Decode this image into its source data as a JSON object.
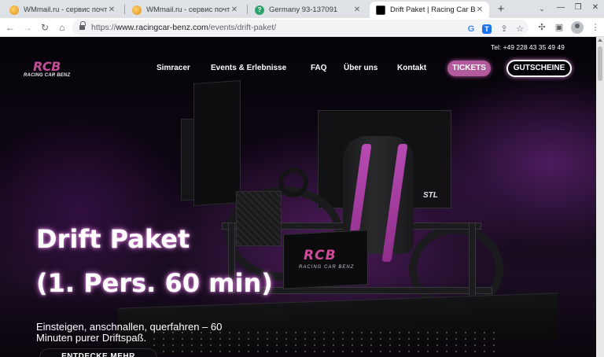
{
  "browser": {
    "tabs": [
      {
        "title": "WMmail.ru - сервис почтовы",
        "icon": "wmmail-favicon"
      },
      {
        "title": "WMmail.ru - сервис почтовы",
        "icon": "wmmail-favicon"
      },
      {
        "title": "Germany 93-137091",
        "icon": "question-favicon"
      },
      {
        "title": "Drift Paket | Racing Car Benz",
        "icon": "rcb-favicon",
        "active": true
      }
    ],
    "new_tab": "+",
    "url_scheme": "https://",
    "url_host": "www.racingcar-benz.com",
    "url_path": "/events/drift-paket/"
  },
  "site": {
    "logo_mark": "RCB",
    "logo_text": "RACING CAR BENZ",
    "phone": "Tel: +49 228 43 35 49 49",
    "nav": {
      "simracer": "Simracer",
      "events": "Events & Erlebnisse",
      "faq": "FAQ",
      "ueber_uns": "Über uns",
      "kontakt": "Kontakt",
      "tickets": "TICKETS",
      "gutscheine": "GUTSCHEINE"
    },
    "hero": {
      "title_line1": "Drift Paket",
      "title_line2": "(1. Pers. 60 min)",
      "subtitle": "Einsteigen, anschnallen, querfahren – 60 Minuten purer Driftspaß.",
      "cta": "ENTDECKE MEHR"
    },
    "simulator": {
      "base_logo": "RCB",
      "base_sub": "RACING CAR BENZ",
      "side_logo": "STL"
    }
  },
  "colors": {
    "accent": "#b25a9b",
    "logo_pink": "#c24b96",
    "background": "#000000"
  }
}
